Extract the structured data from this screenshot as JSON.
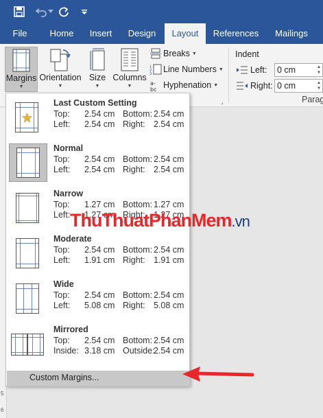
{
  "tabs": [
    "File",
    "Home",
    "Insert",
    "Design",
    "Layout",
    "References",
    "Mailings"
  ],
  "ribbon": {
    "margins": "Margins",
    "orientation": "Orientation",
    "size": "Size",
    "columns": "Columns",
    "breaks": "Breaks",
    "line_numbers": "Line Numbers",
    "hyphenation": "Hyphenation",
    "indent": "Indent",
    "left_label": "Left:",
    "right_label": "Right:",
    "left_value": "0 cm",
    "right_value": "0 cm",
    "paragraph_group": "Paragr"
  },
  "menu": {
    "items": [
      {
        "name": "Last Custom Setting",
        "l1": "Top:",
        "v1": "2.54 cm",
        "l2": "Bottom:",
        "v2": "2.54 cm",
        "l3": "Left:",
        "v3": "2.54 cm",
        "l4": "Right:",
        "v4": "2.54 cm"
      },
      {
        "name": "Normal",
        "l1": "Top:",
        "v1": "2.54 cm",
        "l2": "Bottom:",
        "v2": "2.54 cm",
        "l3": "Left:",
        "v3": "2.54 cm",
        "l4": "Right:",
        "v4": "2.54 cm"
      },
      {
        "name": "Narrow",
        "l1": "Top:",
        "v1": "1.27 cm",
        "l2": "Bottom:",
        "v2": "1.27 cm",
        "l3": "Left:",
        "v3": "1.27 cm",
        "l4": "Right:",
        "v4": "1.27 cm"
      },
      {
        "name": "Moderate",
        "l1": "Top:",
        "v1": "2.54 cm",
        "l2": "Bottom:",
        "v2": "2.54 cm",
        "l3": "Left:",
        "v3": "1.91 cm",
        "l4": "Right:",
        "v4": "1.91 cm"
      },
      {
        "name": "Wide",
        "l1": "Top:",
        "v1": "2.54 cm",
        "l2": "Bottom:",
        "v2": "2.54 cm",
        "l3": "Left:",
        "v3": "5.08 cm",
        "l4": "Right:",
        "v4": "5.08 cm"
      },
      {
        "name": "Mirrored",
        "l1": "Top:",
        "v1": "2.54 cm",
        "l2": "Bottom:",
        "v2": "2.54 cm",
        "l3": "Inside:",
        "v3": "3.18 cm",
        "l4": "Outside:",
        "v4": "2.54 cm"
      }
    ],
    "custom_margins": "Custom Margins..."
  },
  "watermark": {
    "part1": "Thu",
    "part2": "Thuat",
    "part3": "Phan",
    "part4": "Mem",
    "part5": ".vn"
  },
  "ruler": [
    "5",
    "6"
  ],
  "colors": {
    "title_bar": "#2b579a",
    "arrow": "#e8272a"
  }
}
